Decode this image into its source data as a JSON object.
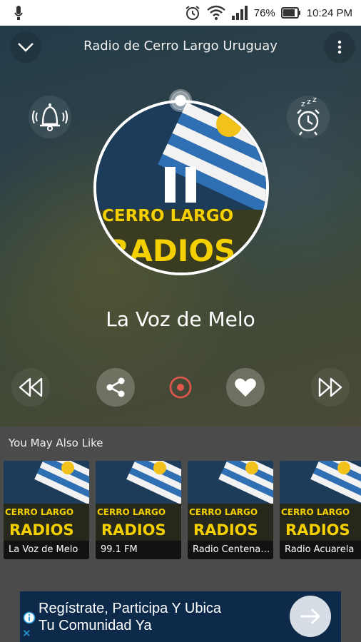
{
  "status_bar": {
    "battery_percent": "76%",
    "time": "10:24 PM",
    "icons": [
      "notification-icon",
      "alarm-clock-icon",
      "wifi-icon",
      "signal-icon",
      "battery-icon"
    ]
  },
  "player": {
    "title": "Radio de Cerro Largo Uruguay",
    "station_name": "La Voz de Melo",
    "artwork_text_line1": "CERRO LARGO",
    "artwork_text_line2": "RADIOS",
    "is_playing": true,
    "icons": {
      "back": "chevron-down-icon",
      "menu": "more-vert-icon",
      "alarm": "bell-icon",
      "sleep": "sleep-timer-icon",
      "prev": "rewind-icon",
      "share": "share-icon",
      "record": "record-icon",
      "favorite": "heart-icon",
      "next": "fast-forward-icon"
    },
    "colors": {
      "record": "#e2574c",
      "accent": "#ffffff"
    }
  },
  "recommendations": {
    "heading": "You May Also Like",
    "items": [
      {
        "label": "La Voz de Melo",
        "art_line1": "CERRO LARGO",
        "art_line2": "RADIOS"
      },
      {
        "label": "99.1 FM",
        "art_line1": "CERRO LARGO",
        "art_line2": "RADIOS"
      },
      {
        "label": "Radio Centenario",
        "art_line1": "CERRO LARGO",
        "art_line2": "RADIOS"
      },
      {
        "label": "Radio Acuarela",
        "art_line1": "CERRO LARGO",
        "art_line2": "RADIOS"
      }
    ]
  },
  "ad": {
    "line1": "Regístrate, Participa Y Ubica",
    "line2": "Tu Comunidad Ya",
    "close_glyph": "✕"
  }
}
